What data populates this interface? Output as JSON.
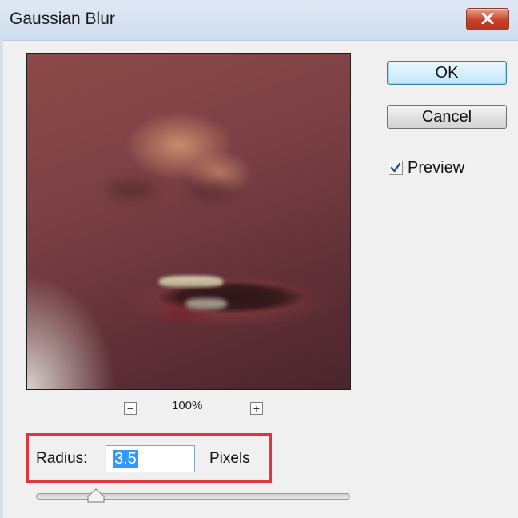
{
  "window": {
    "title": "Gaussian Blur",
    "close_icon": "close-icon"
  },
  "preview": {
    "zoom_level": "100%",
    "zoom_out_symbol": "−",
    "zoom_in_symbol": "+"
  },
  "buttons": {
    "ok_label": "OK",
    "cancel_label": "Cancel"
  },
  "preview_toggle": {
    "label": "Preview",
    "checked": true
  },
  "radius": {
    "label": "Radius:",
    "value": "3.5",
    "unit": "Pixels",
    "slider_fraction": 0.19
  },
  "colors": {
    "highlight_border": "#e0363b",
    "selection": "#3399ff",
    "close_button": "#c7422b"
  }
}
